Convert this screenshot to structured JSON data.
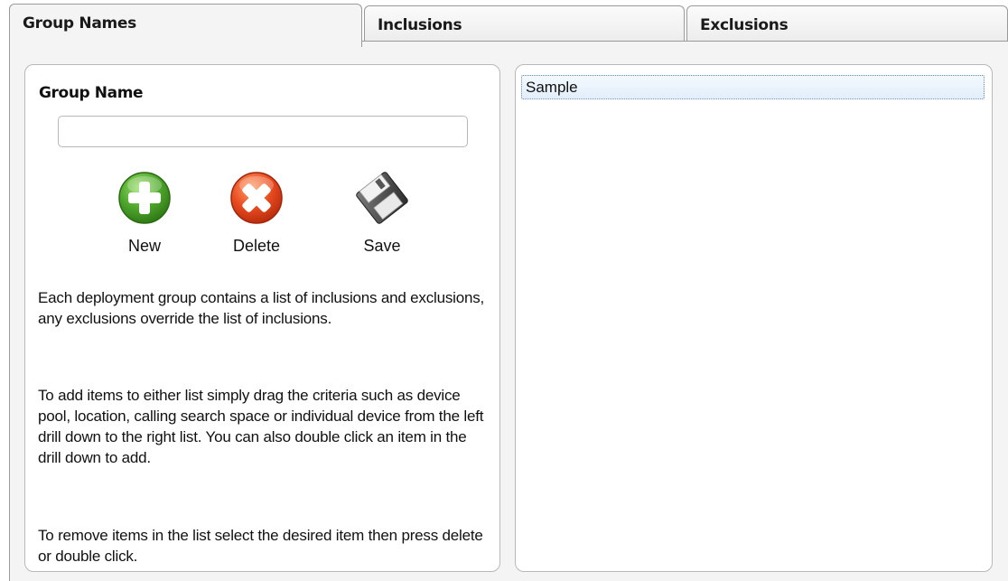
{
  "tabs": [
    {
      "label": "Group Names",
      "active": true
    },
    {
      "label": "Inclusions",
      "active": false
    },
    {
      "label": "Exclusions",
      "active": false
    }
  ],
  "left_panel": {
    "group_name_label": "Group Name",
    "group_name_value": "",
    "buttons": {
      "new": {
        "label": "New",
        "icon": "plus-circle-icon",
        "color": "#4a9a2a"
      },
      "delete": {
        "label": "Delete",
        "icon": "close-circle-icon",
        "color": "#e0441f"
      },
      "save": {
        "label": "Save",
        "icon": "floppy-disk-icon",
        "color": "#555555"
      }
    },
    "help": [
      "Each deployment group contains a list of inclusions and exclusions, any exclusions override the list of inclusions.",
      "To add items to either list simply drag the criteria such as device pool, location, calling search space or individual device from the left drill down to the right list.  You can also double click an item in the drill down to add.",
      "To remove items in the list select the desired item then press delete or double click."
    ]
  },
  "group_list": {
    "items": [
      "Sample"
    ],
    "selected": "Sample"
  }
}
